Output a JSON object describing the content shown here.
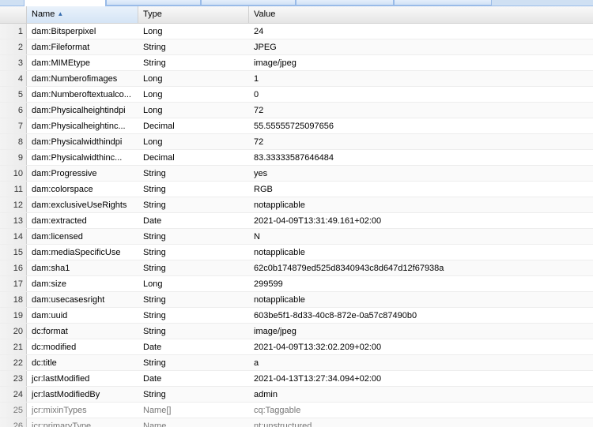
{
  "columns": {
    "name": "Name",
    "type": "Type",
    "value": "Value"
  },
  "sort_indicator": "▲",
  "rows": [
    {
      "n": "1",
      "name": "dam:Bitsperpixel",
      "type": "Long",
      "value": "24"
    },
    {
      "n": "2",
      "name": "dam:Fileformat",
      "type": "String",
      "value": "JPEG"
    },
    {
      "n": "3",
      "name": "dam:MIMEtype",
      "type": "String",
      "value": "image/jpeg"
    },
    {
      "n": "4",
      "name": "dam:Numberofimages",
      "type": "Long",
      "value": "1"
    },
    {
      "n": "5",
      "name": "dam:Numberoftextualco...",
      "type": "Long",
      "value": "0"
    },
    {
      "n": "6",
      "name": "dam:Physicalheightindpi",
      "type": "Long",
      "value": "72"
    },
    {
      "n": "7",
      "name": "dam:Physicalheightinc...",
      "type": "Decimal",
      "value": "55.55555725097656"
    },
    {
      "n": "8",
      "name": "dam:Physicalwidthindpi",
      "type": "Long",
      "value": "72"
    },
    {
      "n": "9",
      "name": "dam:Physicalwidthinc...",
      "type": "Decimal",
      "value": "83.33333587646484"
    },
    {
      "n": "10",
      "name": "dam:Progressive",
      "type": "String",
      "value": "yes"
    },
    {
      "n": "11",
      "name": "dam:colorspace",
      "type": "String",
      "value": "RGB"
    },
    {
      "n": "12",
      "name": "dam:exclusiveUseRights",
      "type": "String",
      "value": "notapplicable"
    },
    {
      "n": "13",
      "name": "dam:extracted",
      "type": "Date",
      "value": "2021-04-09T13:31:49.161+02:00"
    },
    {
      "n": "14",
      "name": "dam:licensed",
      "type": "String",
      "value": "N"
    },
    {
      "n": "15",
      "name": "dam:mediaSpecificUse",
      "type": "String",
      "value": "notapplicable"
    },
    {
      "n": "16",
      "name": "dam:sha1",
      "type": "String",
      "value": "62c0b174879ed525d8340943c8d647d12f67938a"
    },
    {
      "n": "17",
      "name": "dam:size",
      "type": "Long",
      "value": "299599"
    },
    {
      "n": "18",
      "name": "dam:usecasesright",
      "type": "String",
      "value": "notapplicable"
    },
    {
      "n": "19",
      "name": "dam:uuid",
      "type": "String",
      "value": "603be5f1-8d33-40c8-872e-0a57c87490b0"
    },
    {
      "n": "20",
      "name": "dc:format",
      "type": "String",
      "value": "image/jpeg"
    },
    {
      "n": "21",
      "name": "dc:modified",
      "type": "Date",
      "value": "2021-04-09T13:32:02.209+02:00"
    },
    {
      "n": "22",
      "name": "dc:title",
      "type": "String",
      "value": "a"
    },
    {
      "n": "23",
      "name": "jcr:lastModified",
      "type": "Date",
      "value": "2021-04-13T13:27:34.094+02:00"
    },
    {
      "n": "24",
      "name": "jcr:lastModifiedBy",
      "type": "String",
      "value": "admin"
    },
    {
      "n": "25",
      "name": "jcr:mixinTypes",
      "type": "Name[]",
      "value": "cq:Taggable",
      "dim": true
    },
    {
      "n": "26",
      "name": "jcr:primaryType",
      "type": "Name",
      "value": "nt:unstructured",
      "dim": true
    }
  ]
}
